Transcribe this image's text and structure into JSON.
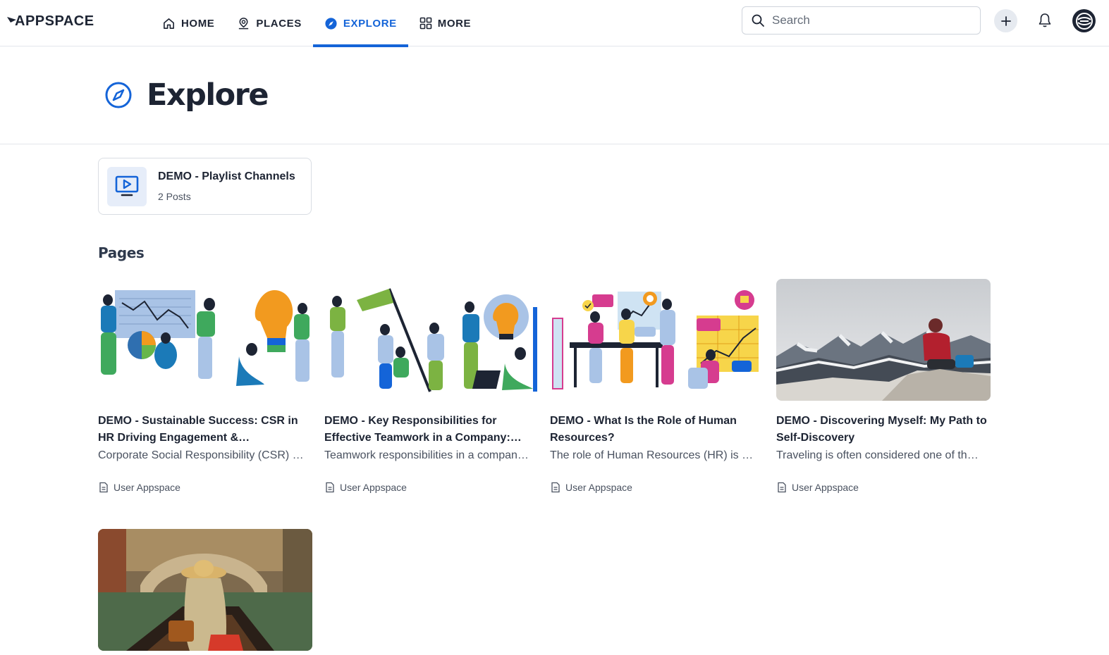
{
  "brand": {
    "logo_text": "APPSPACE",
    "accent": "#1464d8"
  },
  "nav": {
    "items": [
      {
        "label": "HOME",
        "icon": "home-icon",
        "active": false
      },
      {
        "label": "PLACES",
        "icon": "map-pin-icon",
        "active": false
      },
      {
        "label": "EXPLORE",
        "icon": "compass-icon",
        "active": true
      },
      {
        "label": "MORE",
        "icon": "grid-icon",
        "active": false
      }
    ]
  },
  "search": {
    "placeholder": "Search"
  },
  "page": {
    "title": "Explore"
  },
  "channel": {
    "name": "DEMO - Playlist Channels",
    "count": "2 Posts"
  },
  "pages_section": {
    "title": "Pages"
  },
  "cards": [
    {
      "title": "DEMO - Sustainable Success: CSR in HR Driving Engagement & Sustainability",
      "desc": "Corporate Social Responsibility (CSR) in HR",
      "author": "User Appspace",
      "image": "team-illustration-charts-lightbulb"
    },
    {
      "title": "DEMO - Key Responsibilities for Effective Teamwork in a Company: Insights",
      "desc": "Teamwork responsibilities in a company are essential",
      "author": "User Appspace",
      "image": "team-illustration-flag-lightbulb"
    },
    {
      "title": "DEMO - What Is the Role of Human Resources?",
      "desc": "The role of Human Resources (HR) is vital",
      "author": "User Appspace",
      "image": "office-meeting-illustration"
    },
    {
      "title": "DEMO - Discovering Myself: My Path to Self-Discovery",
      "desc": "Traveling is often considered one of the best ways",
      "author": "User Appspace",
      "image": "hiker-on-snowy-mountain-photo"
    },
    {
      "title": "",
      "desc": "",
      "author": "",
      "image": "woman-in-gondola-venice-photo"
    }
  ]
}
